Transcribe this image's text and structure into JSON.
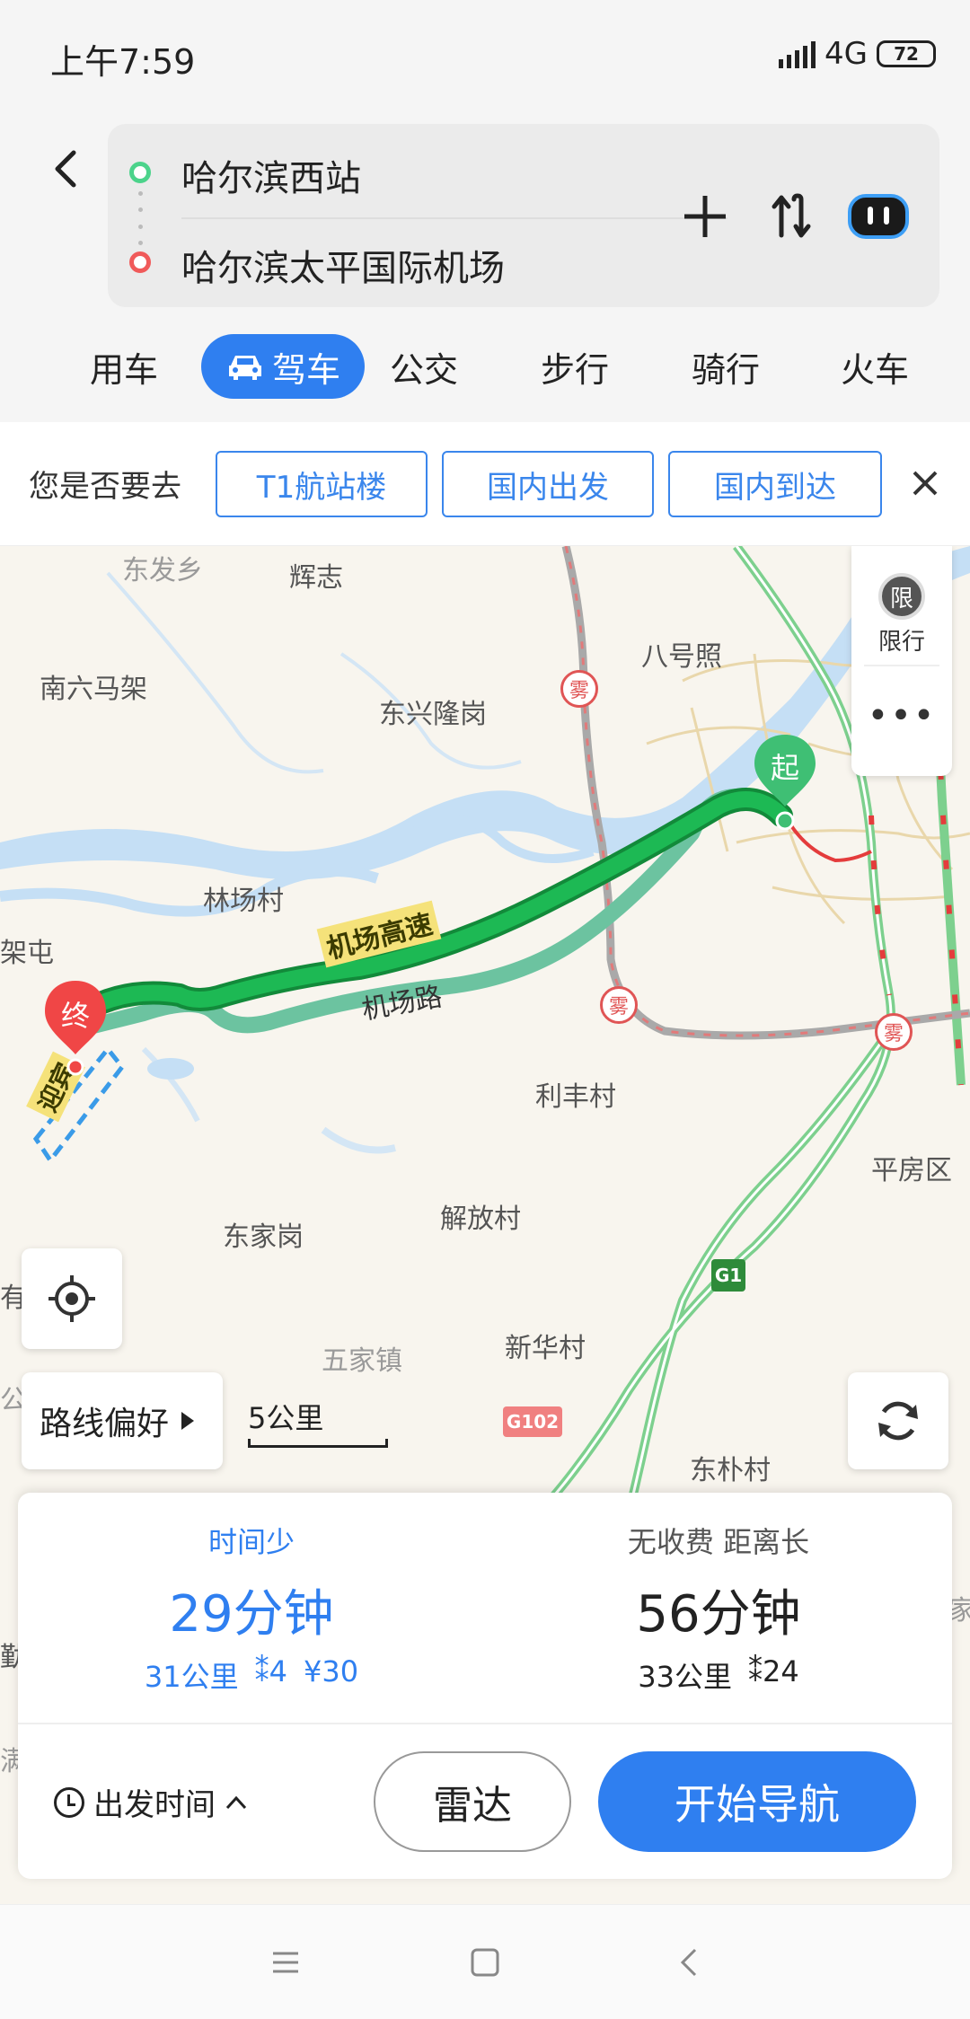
{
  "status_bar": {
    "time": "上午7:59",
    "network": "4G",
    "battery": "72"
  },
  "route": {
    "from": "哈尔滨西站",
    "to": "哈尔滨太平国际机场"
  },
  "mode_tabs": [
    {
      "label": "用车"
    },
    {
      "label": "驾车",
      "active": true
    },
    {
      "label": "公交"
    },
    {
      "label": "步行"
    },
    {
      "label": "骑行"
    },
    {
      "label": "火车"
    }
  ],
  "suggestion": {
    "label": "您是否要去",
    "chips": [
      "T1航站楼",
      "国内出发",
      "国内到达"
    ]
  },
  "map": {
    "places": {
      "dongfa": "东发乡",
      "huizhi": "辉志",
      "nanliumajia": "南六马架",
      "dongxinglonggang": "东兴隆岗",
      "bahaozhao": "八号照",
      "lingchangcun": "林场村",
      "jiatun": "架屯",
      "lifengcun": "利丰村",
      "pingfangqu": "平房区",
      "dongjiagang": "东家岗",
      "jiefangcun": "解放村",
      "xinhuacun": "新华村",
      "wujiazhen": "五家镇",
      "dongpucun": "东朴村",
      "you": "有",
      "gong": "公",
      "jia": "家",
      "qin": "勤",
      "man": "满"
    },
    "road_labels": {
      "airport_expressway": "机场高速",
      "airport_road": "机场路",
      "g1": "G1",
      "g102": "G102",
      "bottom_left": "迎宾"
    },
    "fog_label": "雾",
    "start_label": "起",
    "end_label": "终",
    "side_panel": {
      "limit_icon": "限",
      "limit_label": "限行",
      "more": "•••"
    },
    "route_pref": "路线偏好",
    "scale": "5公里"
  },
  "routes": [
    {
      "tag": "时间少",
      "duration": "29分钟",
      "distance": "31公里",
      "lights": "4",
      "toll": "¥30",
      "selected": true
    },
    {
      "tag": "无收费  距离长",
      "duration": "56分钟",
      "distance": "33公里",
      "lights": "24",
      "selected": false
    }
  ],
  "actions": {
    "depart": "出发时间",
    "radar": "雷达",
    "start_nav": "开始导航"
  },
  "colors": {
    "accent": "#2f7ff0",
    "route_main": "#1db954",
    "route_alt": "#6cc3a0",
    "start_green": "#3fbf74",
    "end_red": "#f04646"
  }
}
